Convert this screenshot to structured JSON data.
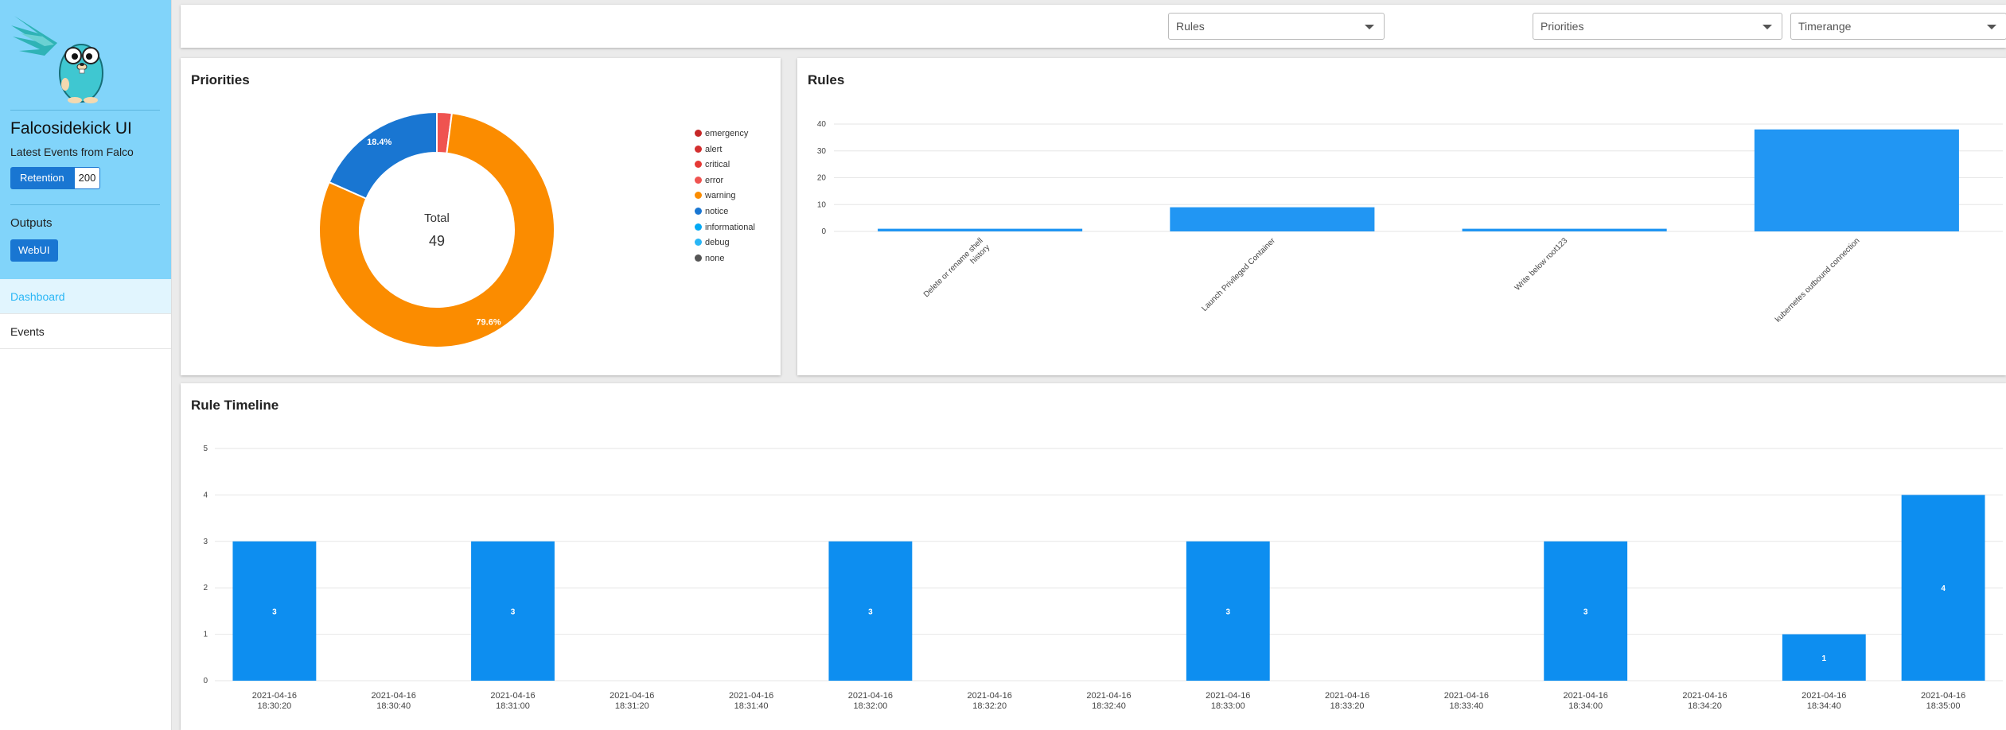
{
  "app": {
    "title": "Falcosidekick UI",
    "subtitle": "Latest Events from Falco",
    "retention_label": "Retention",
    "retention_value": "200",
    "outputs_label": "Outputs",
    "outputs": [
      "WebUI"
    ],
    "accent_color": "#81d4fa",
    "button_color": "#1976d2"
  },
  "nav": {
    "items": [
      {
        "label": "Dashboard",
        "active": true
      },
      {
        "label": "Events",
        "active": false
      }
    ]
  },
  "filters": {
    "rules_placeholder": "Rules",
    "priorities_placeholder": "Priorities",
    "timerange_placeholder": "Timerange"
  },
  "priorities_card": {
    "title": "Priorities",
    "total_label": "Total",
    "total_value": "49"
  },
  "rules_card": {
    "title": "Rules"
  },
  "timeline_card": {
    "title": "Rule Timeline"
  },
  "chart_data": [
    {
      "type": "pie",
      "title": "Priorities",
      "center_label": "Total",
      "center_value": 49,
      "legend": [
        {
          "name": "emergency",
          "color": "#c62828"
        },
        {
          "name": "alert",
          "color": "#d32f2f"
        },
        {
          "name": "critical",
          "color": "#e53935"
        },
        {
          "name": "error",
          "color": "#ef5350"
        },
        {
          "name": "warning",
          "color": "#fb8c00"
        },
        {
          "name": "notice",
          "color": "#1976d2"
        },
        {
          "name": "informational",
          "color": "#03a9f4"
        },
        {
          "name": "debug",
          "color": "#29b6f6"
        },
        {
          "name": "none",
          "color": "#555555"
        }
      ],
      "slices": [
        {
          "name": "error",
          "value": 1,
          "color": "#ef5350",
          "label": ""
        },
        {
          "name": "warning",
          "value": 39,
          "color": "#fb8c00",
          "label": "79.6%"
        },
        {
          "name": "notice",
          "value": 9,
          "color": "#1976d2",
          "label": "18.4%"
        }
      ]
    },
    {
      "type": "bar",
      "title": "Rules",
      "categories": [
        "Delete or rename shell history",
        "Launch Privileged Container",
        "Write below root123",
        "kubernetes outbound connection"
      ],
      "values": [
        1,
        9,
        1,
        38
      ],
      "ylim": [
        0,
        40
      ],
      "yticks": [
        "0",
        "10",
        "20",
        "30",
        "40"
      ],
      "color": "#2196f3"
    },
    {
      "type": "bar",
      "title": "Rule Timeline",
      "categories": [
        {
          "date": "2021-04-16",
          "time": "18:30:20"
        },
        {
          "date": "2021-04-16",
          "time": "18:30:40"
        },
        {
          "date": "2021-04-16",
          "time": "18:31:00"
        },
        {
          "date": "2021-04-16",
          "time": "18:31:20"
        },
        {
          "date": "2021-04-16",
          "time": "18:31:40"
        },
        {
          "date": "2021-04-16",
          "time": "18:32:00"
        },
        {
          "date": "2021-04-16",
          "time": "18:32:20"
        },
        {
          "date": "2021-04-16",
          "time": "18:32:40"
        },
        {
          "date": "2021-04-16",
          "time": "18:33:00"
        },
        {
          "date": "2021-04-16",
          "time": "18:33:20"
        },
        {
          "date": "2021-04-16",
          "time": "18:33:40"
        },
        {
          "date": "2021-04-16",
          "time": "18:34:00"
        },
        {
          "date": "2021-04-16",
          "time": "18:34:20"
        },
        {
          "date": "2021-04-16",
          "time": "18:34:40"
        },
        {
          "date": "2021-04-16",
          "time": "18:35:00"
        }
      ],
      "values": [
        3,
        0,
        3,
        0,
        0,
        3,
        0,
        0,
        3,
        0,
        0,
        3,
        0,
        1,
        4
      ],
      "ylim": [
        0,
        5
      ],
      "yticks": [
        "0",
        "1",
        "2",
        "3",
        "4",
        "5"
      ],
      "color": "#0d8ef0"
    }
  ]
}
